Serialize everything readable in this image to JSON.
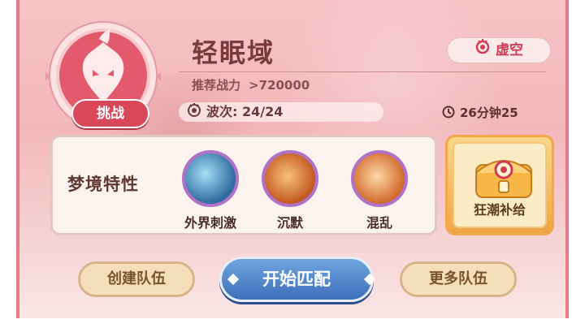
{
  "stage": {
    "name": "轻眠域",
    "recommended_power_label": "推荐战力",
    "recommended_power_value": ">720000",
    "difficulty_badge": "挑战",
    "wave_label": "波次:",
    "wave_value": "24/24",
    "type_label": "虚空",
    "timer_value": "26分钟25"
  },
  "traits": {
    "label": "梦境特性",
    "items": [
      {
        "name": "外界刺激",
        "icon": "blue-energy-icon"
      },
      {
        "name": "沉默",
        "icon": "silence-icon"
      },
      {
        "name": "混乱",
        "icon": "chaos-icon"
      }
    ]
  },
  "supply": {
    "label": "狂潮补给",
    "icon": "treasure-chest-icon"
  },
  "buttons": {
    "create_team": "创建队伍",
    "start_match": "开始匹配",
    "more_teams": "更多队伍"
  },
  "colors": {
    "panel_bg": "#f2b7bc",
    "badge_red": "#d9475a",
    "start_blue": "#3d6fb8",
    "supply_gold": "#f0a545"
  }
}
